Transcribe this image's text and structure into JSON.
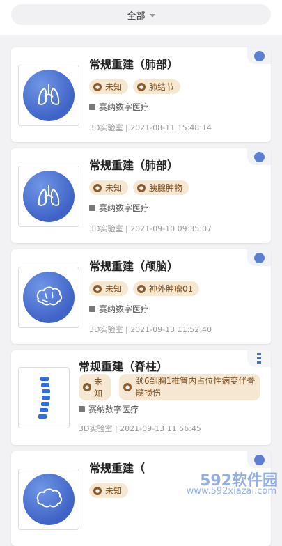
{
  "filter": {
    "label": "全部",
    "icon": "caret-down-icon"
  },
  "cards": [
    {
      "title": "常规重建（肺部）",
      "tags": [
        "未知",
        "肺结节"
      ],
      "org": "赛纳数字医疗",
      "meta": "3D实验室 | 2021-08-11 15:48:14",
      "organ_icon": "lung-icon"
    },
    {
      "title": "常规重建（肺部）",
      "tags": [
        "未知",
        "胰腺肿物"
      ],
      "org": "赛纳数字医疗",
      "meta": "3D实验室 | 2021-09-10 09:35:07",
      "organ_icon": "lung-icon"
    },
    {
      "title": "常规重建（颅脑）",
      "tags": [
        "未知",
        "神外肿瘤01"
      ],
      "org": "赛纳数字医疗",
      "meta": "3D实验室 | 2021-09-13 11:52:40",
      "organ_icon": "brain-icon"
    },
    {
      "title": "常规重建（脊柱）",
      "tags": [
        "未知",
        "颈6到胸1椎管内占位性病变伴脊髓损伤"
      ],
      "org": "赛纳数字医疗",
      "meta": "3D实验室 | 2021-09-13 11:56:45",
      "organ_icon": "spine-icon"
    },
    {
      "title": "常规重建（",
      "tags": [
        "未知"
      ],
      "org": "",
      "meta": "",
      "organ_icon": "brain-icon"
    }
  ],
  "watermark": {
    "text": "592软件园",
    "url": "www.592xiazai.com"
  }
}
